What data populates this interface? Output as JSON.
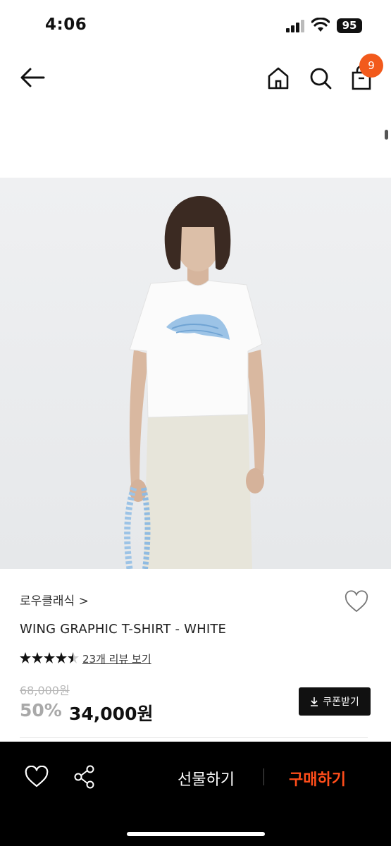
{
  "status_bar": {
    "time": "4:06",
    "battery": "95"
  },
  "nav": {
    "cart_count": "9"
  },
  "product": {
    "brand": "로우클래식 >",
    "title": "WING GRAPHIC T-SHIRT - WHITE",
    "rating": 4.5,
    "review_link": "23개 리뷰 보기",
    "original_price": "68,000원",
    "discount": "50%",
    "sale_price": "34,000원",
    "coupon_label": "쿠폰받기"
  },
  "bottom_bar": {
    "gift_label": "선물하기",
    "buy_label": "구매하기"
  },
  "colors": {
    "accent": "#f25a1c",
    "buy": "#ff4d1a",
    "bar": "#000000"
  }
}
